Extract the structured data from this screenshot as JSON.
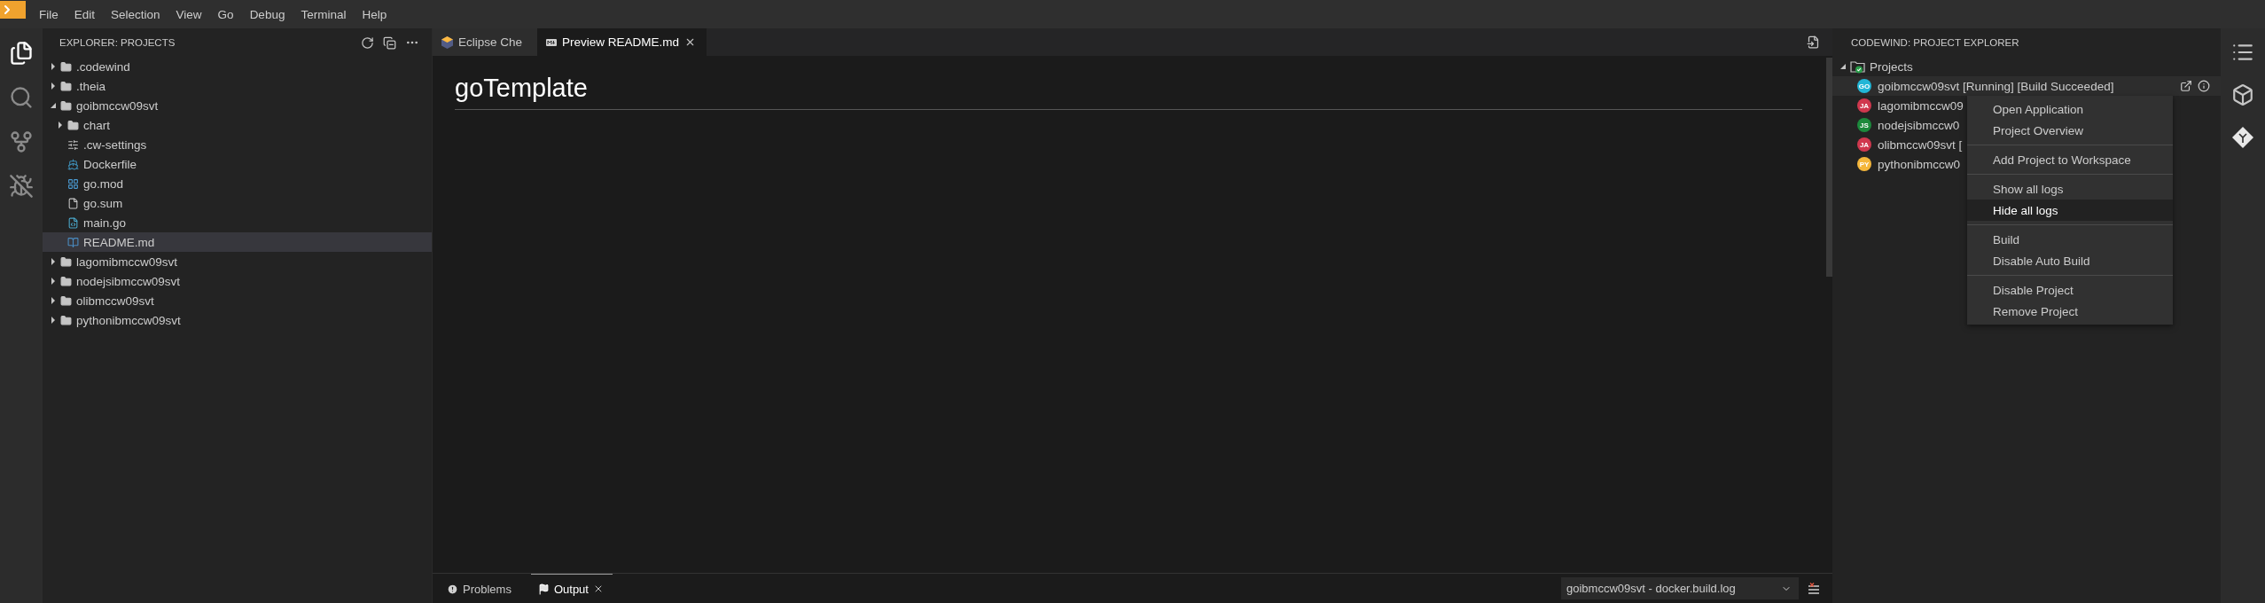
{
  "menu_bar": {
    "items": [
      "File",
      "Edit",
      "Selection",
      "View",
      "Go",
      "Debug",
      "Terminal",
      "Help"
    ]
  },
  "activity_bar": [
    {
      "kind": "explorer",
      "selected": true
    },
    {
      "kind": "search",
      "selected": false
    },
    {
      "kind": "scm",
      "selected": false
    },
    {
      "kind": "debug",
      "selected": false
    }
  ],
  "explorer": {
    "title": "EXPLORER: PROJECTS",
    "tree": [
      {
        "label": ".codewind",
        "kind": "folder",
        "expanded": false,
        "selected": false
      },
      {
        "label": ".theia",
        "kind": "folder",
        "expanded": false,
        "selected": false
      },
      {
        "label": "goibmccw09svt",
        "kind": "folder",
        "expanded": true,
        "selected": false,
        "children": [
          {
            "label": "chart",
            "kind": "folder",
            "expanded": false,
            "selected": false
          },
          {
            "label": ".cw-settings",
            "kind": "settings",
            "selected": false
          },
          {
            "label": "Dockerfile",
            "kind": "docker",
            "selected": false
          },
          {
            "label": "go.mod",
            "kind": "module",
            "selected": false
          },
          {
            "label": "go.sum",
            "kind": "file",
            "selected": false
          },
          {
            "label": "main.go",
            "kind": "go",
            "selected": false
          },
          {
            "label": "README.md",
            "kind": "markdown",
            "selected": true
          }
        ]
      },
      {
        "label": "lagomibmccw09svt",
        "kind": "folder",
        "expanded": false,
        "selected": false
      },
      {
        "label": "nodejsibmccw09svt",
        "kind": "folder",
        "expanded": false,
        "selected": false
      },
      {
        "label": "olibmccw09svt",
        "kind": "folder",
        "expanded": false,
        "selected": false
      },
      {
        "label": "pythonibmccw09svt",
        "kind": "folder",
        "expanded": false,
        "selected": false
      }
    ]
  },
  "editor": {
    "tabs": [
      {
        "label": "Eclipse Che",
        "kind": "che",
        "selected": false,
        "closable": false
      },
      {
        "label": "Preview README.md",
        "kind": "markdown",
        "selected": true,
        "closable": true
      }
    ],
    "preview": {
      "heading": "goTemplate"
    }
  },
  "panel": {
    "tabs": [
      {
        "label": "Problems",
        "kind": "problems",
        "selected": false,
        "closable": false
      },
      {
        "label": "Output",
        "kind": "output",
        "selected": true,
        "closable": true
      }
    ],
    "channel": "goibmccw09svt - docker.build.log"
  },
  "project_explorer": {
    "title": "CODEWIND: PROJECT EXPLORER",
    "root": {
      "label": "Projects",
      "expanded": true
    },
    "projects": [
      {
        "badge": "GO",
        "color": "#22b6d6",
        "label": "goibmccw09svt [Running] [Build Succeeded]",
        "selected": true
      },
      {
        "badge": "JA",
        "color": "#d0384e",
        "label": "lagomibmccw09",
        "selected": false
      },
      {
        "badge": "JS",
        "color": "#1c8a3c",
        "label": "nodejsibmccw0",
        "selected": false
      },
      {
        "badge": "JA",
        "color": "#d0384e",
        "label": "olibmccw09svt [",
        "selected": false
      },
      {
        "badge": "PY",
        "color": "#f4b63b",
        "label": "pythonibmccw0",
        "selected": false
      }
    ]
  },
  "context_menu": {
    "groups": [
      [
        {
          "label": "Open Application",
          "selected": false
        },
        {
          "label": "Project Overview",
          "selected": false
        }
      ],
      [
        {
          "label": "Add Project to Workspace",
          "selected": false
        }
      ],
      [
        {
          "label": "Show all logs",
          "selected": false
        },
        {
          "label": "Hide all logs",
          "selected": true
        }
      ],
      [
        {
          "label": "Build",
          "selected": false
        },
        {
          "label": "Disable Auto Build",
          "selected": false
        }
      ],
      [
        {
          "label": "Disable Project",
          "selected": false
        },
        {
          "label": "Remove Project",
          "selected": false
        }
      ]
    ]
  }
}
